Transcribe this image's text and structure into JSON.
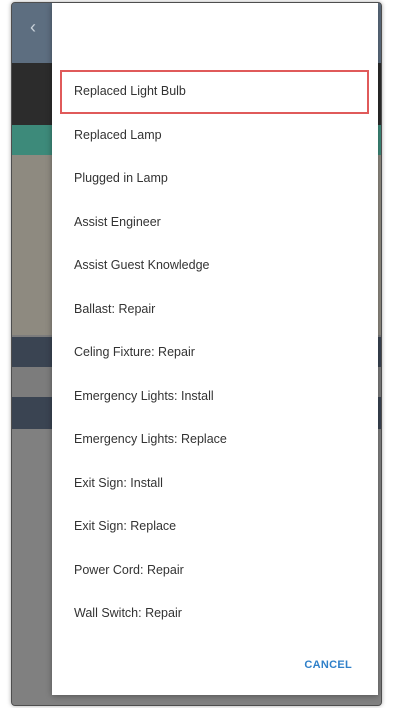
{
  "dialog": {
    "options": [
      "Replaced Light Bulb",
      "Replaced Lamp",
      "Plugged in Lamp",
      "Assist Engineer",
      "Assist Guest Knowledge",
      "Ballast: Repair",
      "Celing Fixture: Repair",
      "Emergency Lights: Install",
      "Emergency Lights: Replace",
      "Exit Sign: Install",
      "Exit Sign: Replace",
      "Power Cord: Repair",
      "Wall Switch: Repair"
    ],
    "highlighted_index": 0,
    "cancel_label": "CANCEL"
  },
  "colors": {
    "highlight_border": "#e05a5a",
    "cancel": "#2f80c9",
    "scrim": "#7c7c7c"
  },
  "icons": {
    "back": "back-arrow-icon",
    "menu": "more-vert-icon",
    "warning": "warning-icon"
  }
}
